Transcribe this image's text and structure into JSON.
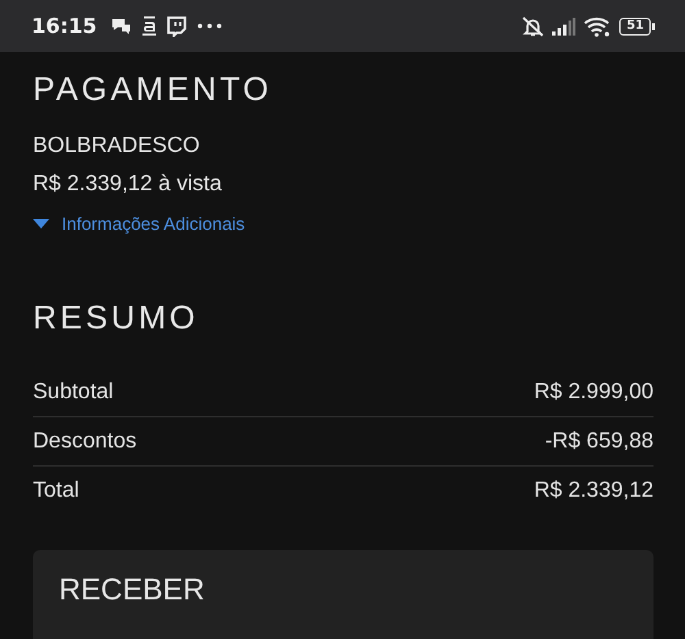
{
  "status_bar": {
    "time": "16:15",
    "battery": "51"
  },
  "payment": {
    "title": "PAGAMENTO",
    "method": "BOLBRADESCO",
    "amount": "R$ 2.339,12 à vista",
    "more_info": {
      "label": "Informações Adicionais",
      "expanded": false
    }
  },
  "summary": {
    "title": "RESUMO",
    "rows": [
      {
        "label": "Subtotal",
        "value": "R$ 2.999,00"
      },
      {
        "label": "Descontos",
        "value": "-R$ 659,88"
      },
      {
        "label": "Total",
        "value": "R$ 2.339,12"
      }
    ]
  },
  "receive_card": {
    "title": "RECEBER"
  }
}
